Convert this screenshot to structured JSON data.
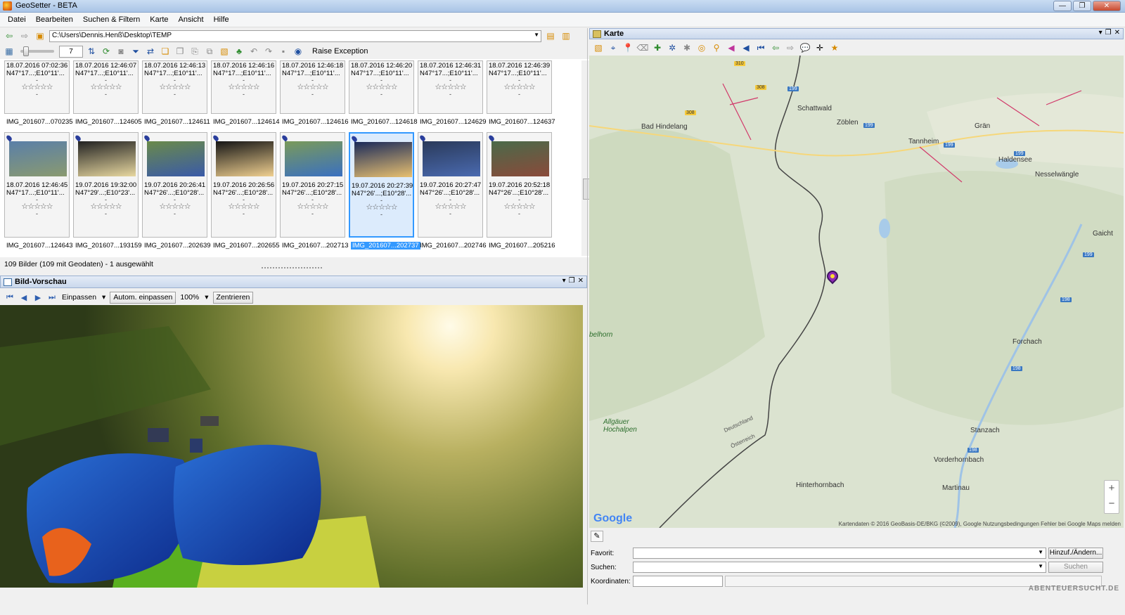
{
  "window": {
    "title": "GeoSetter - BETA"
  },
  "menu": [
    "Datei",
    "Bearbeiten",
    "Suchen & Filtern",
    "Karte",
    "Ansicht",
    "Hilfe"
  ],
  "address": {
    "path": "C:\\Users\\Dennis.Henß\\Desktop\\TEMP"
  },
  "toolbar": {
    "zoom_value": "7",
    "raise_label": "Raise Exception"
  },
  "thumbs_row1": [
    {
      "date": "18.07.2016 07:02:36",
      "coords": "N47°17...;E10°11'...",
      "file": "IMG_201607...070235"
    },
    {
      "date": "18.07.2016 12:46:07",
      "coords": "N47°17...;E10°11'...",
      "file": "IMG_201607...124605"
    },
    {
      "date": "18.07.2016 12:46:13",
      "coords": "N47°17...;E10°11'...",
      "file": "IMG_201607...124611"
    },
    {
      "date": "18.07.2016 12:46:16",
      "coords": "N47°17...;E10°11'...",
      "file": "IMG_201607...124614"
    },
    {
      "date": "18.07.2016 12:46:18",
      "coords": "N47°17...;E10°11'...",
      "file": "IMG_201607...124616"
    },
    {
      "date": "18.07.2016 12:46:20",
      "coords": "N47°17...;E10°11'...",
      "file": "IMG_201607...124618"
    },
    {
      "date": "18.07.2016 12:46:31",
      "coords": "N47°17...;E10°11'...",
      "file": "IMG_201607...124629"
    },
    {
      "date": "18.07.2016 12:46:39",
      "coords": "N47°17...;E10°11'...",
      "file": "IMG_201607...124637"
    }
  ],
  "thumbs_row2": [
    {
      "date": "18.07.2016 12:46:45",
      "coords": "N47°17...;E10°11'...",
      "file": "IMG_201607...124643"
    },
    {
      "date": "19.07.2016 19:32:00",
      "coords": "N47°29'...;E10°23'...",
      "file": "IMG_201607...193159"
    },
    {
      "date": "19.07.2016 20:26:41",
      "coords": "N47°26'...;E10°28'...",
      "file": "IMG_201607...202639"
    },
    {
      "date": "19.07.2016 20:26:56",
      "coords": "N47°26'...;E10°28'...",
      "file": "IMG_201607...202655"
    },
    {
      "date": "19.07.2016 20:27:15",
      "coords": "N47°26'...;E10°28'...",
      "file": "IMG_201607...202713"
    },
    {
      "date": "19.07.2016 20:27:39",
      "coords": "N47°26'...;E10°28'...",
      "file": "IMG_201607...202737"
    },
    {
      "date": "19.07.2016 20:27:47",
      "coords": "N47°26'...;E10°28'...",
      "file": "IMG_201607...202746"
    },
    {
      "date": "19.07.2016 20:52:18",
      "coords": "N47°26'...;E10°28'...",
      "file": "IMG_201607...205216"
    }
  ],
  "rating_stars": "☆☆☆☆☆",
  "status": {
    "text": "109 Bilder (109 mit Geodaten) - 1 ausgewählt"
  },
  "preview": {
    "title": "Bild-Vorschau",
    "fit_label": "Einpassen",
    "auto_fit_label": "Autom. einpassen",
    "zoom_label": "100%",
    "center_label": "Zentrieren"
  },
  "map": {
    "title": "Karte",
    "labels": [
      "Schattwald",
      "Zöblen",
      "Bad Hindelang",
      "Grän",
      "Tannheim",
      "Haldensee",
      "Nesselwängle",
      "Gaicht",
      "Forchach",
      "Allgäuer Hochalpen",
      "Stanzach",
      "Vorderhornbach",
      "Hinterhornbach",
      "Martinau",
      "Deutschland",
      "Österreich",
      "belhorn"
    ],
    "road_signs": [
      "310",
      "308",
      "308",
      "199",
      "199",
      "199",
      "199",
      "199",
      "198",
      "198",
      "198"
    ],
    "google": "Google",
    "attribution": "Kartendaten © 2016 GeoBasis-DE/BKG (©2009), Google   Nutzungsbedingungen   Fehler bei Google Maps melden"
  },
  "mapform": {
    "favorite_label": "Favorit:",
    "search_label": "Suchen:",
    "coords_label": "Koordinaten:",
    "add_change_btn": "Hinzuf./Ändern...",
    "search_btn": "Suchen"
  },
  "watermark": "ABENTEUERSUCHT.DE"
}
